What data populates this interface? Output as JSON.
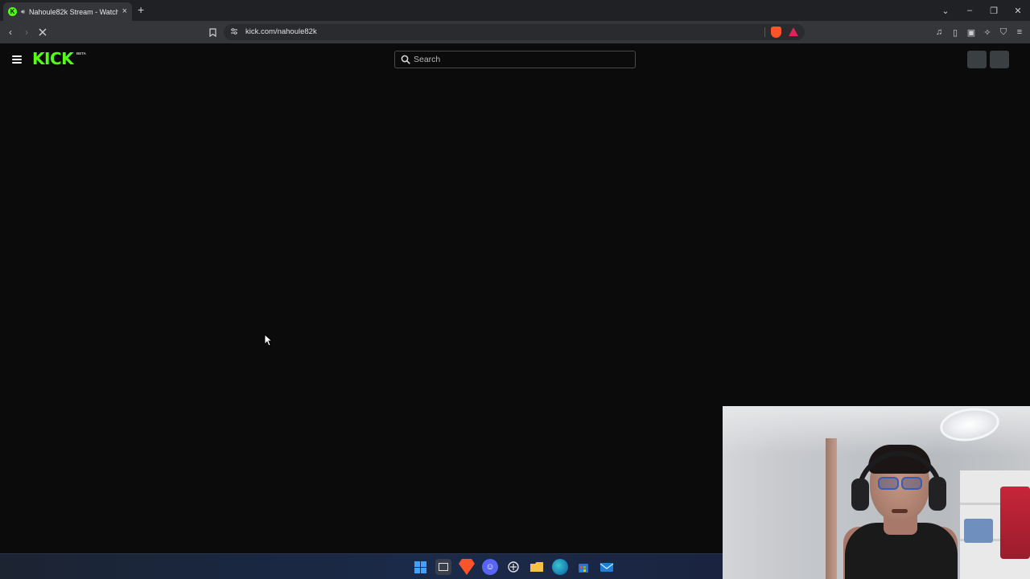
{
  "browser": {
    "tab": {
      "title": "Nahoule82k Stream - Watch",
      "favicon_letter": "K",
      "audio_icon": "speaker-icon",
      "close_label": "×"
    },
    "new_tab_label": "+",
    "window_controls": {
      "tabs_menu": "⌄",
      "minimize": "–",
      "restore": "❐",
      "close": "✕"
    },
    "toolbar": {
      "back": "‹",
      "forward": "›",
      "reload": "⟳",
      "bookmark": "bookmark-icon",
      "site_info": "tune-icon",
      "url": "kick.com/nahoule82k",
      "right_icons": [
        "media-icon",
        "sidebar-icon",
        "wallet-icon",
        "leo-icon",
        "vpn-icon",
        "menu-icon"
      ]
    }
  },
  "kick": {
    "logo_text": "KICK",
    "beta_label": "BETA",
    "search": {
      "placeholder": "Search",
      "value": ""
    },
    "colors": {
      "brand": "#53fc18",
      "background": "#0b0b0c",
      "skeleton": "#3a3f41"
    }
  },
  "taskbar": {
    "icons": [
      "windows-start-icon",
      "task-view-icon",
      "brave-browser-icon",
      "discord-icon",
      "chatgpt-icon",
      "file-explorer-icon",
      "edge-icon",
      "microsoft-store-icon",
      "mail-icon"
    ]
  }
}
